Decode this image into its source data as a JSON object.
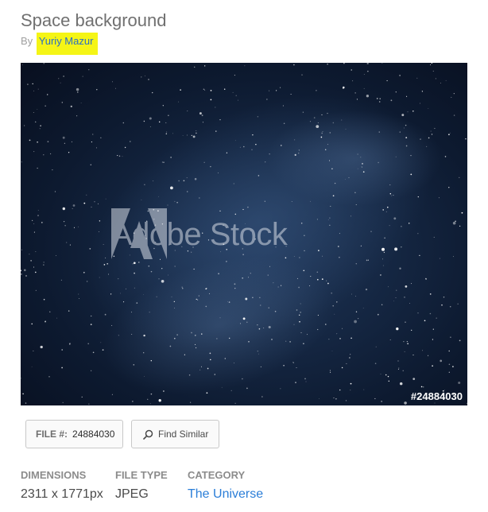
{
  "header": {
    "title": "Space background",
    "by_label": "By",
    "author": "Yuriy Mazur"
  },
  "image": {
    "watermark_text": "Adobe Stock",
    "overlay_file_id": "#24884030"
  },
  "actions": {
    "file_label": "FILE #:",
    "file_value": "24884030",
    "find_similar_label": "Find Similar"
  },
  "details": [
    {
      "label": "DIMENSIONS",
      "value": "2311 x 1771px"
    },
    {
      "label": "FILE TYPE",
      "value": "JPEG"
    },
    {
      "label": "CATEGORY",
      "value": "The Universe"
    }
  ],
  "colors": {
    "highlight": "#f5f516",
    "link": "#2b7ed8"
  }
}
